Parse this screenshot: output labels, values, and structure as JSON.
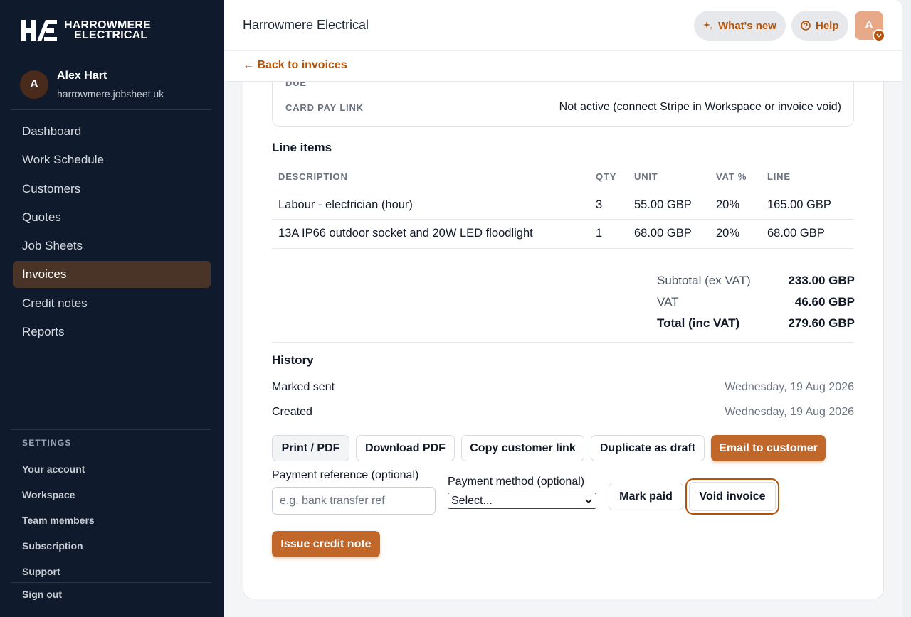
{
  "brand": {
    "name_line1": "HARROWMERE",
    "name_line2": "ELECTRICAL"
  },
  "user": {
    "initial": "A",
    "name": "Alex Hart",
    "domain": "harrowmere.jobsheet.uk"
  },
  "nav": [
    {
      "label": "Dashboard",
      "name": "dashboard",
      "active": false
    },
    {
      "label": "Work Schedule",
      "name": "work-schedule",
      "active": false
    },
    {
      "label": "Customers",
      "name": "customers",
      "active": false
    },
    {
      "label": "Quotes",
      "name": "quotes",
      "active": false
    },
    {
      "label": "Job Sheets",
      "name": "job-sheets",
      "active": false
    },
    {
      "label": "Invoices",
      "name": "invoices",
      "active": true
    },
    {
      "label": "Credit notes",
      "name": "credit-notes",
      "active": false
    },
    {
      "label": "Reports",
      "name": "reports",
      "active": false
    }
  ],
  "settings": {
    "heading": "SETTINGS",
    "items": [
      "Your account",
      "Workspace",
      "Team members",
      "Subscription",
      "Support"
    ],
    "sign_out": "Sign out"
  },
  "header": {
    "title": "Harrowmere Electrical",
    "whats_new": "What's new",
    "help": "Help",
    "avatar_initial": "A",
    "back_link": "← Back to invoices"
  },
  "payment_box": {
    "due_label_clipped": "DUE",
    "card_pay_label": "CARD PAY LINK",
    "card_pay_value": "Not active (connect Stripe in Workspace or invoice void)"
  },
  "line_items": {
    "heading": "Line items",
    "columns": [
      "DESCRIPTION",
      "QTY",
      "UNIT",
      "VAT %",
      "LINE"
    ],
    "rows": [
      [
        "Labour - electrician (hour)",
        "3",
        "55.00 GBP",
        "20%",
        "165.00 GBP"
      ],
      [
        "13A IP66 outdoor socket and 20W LED floodlight",
        "1",
        "68.00 GBP",
        "20%",
        "68.00 GBP"
      ]
    ]
  },
  "totals": {
    "subtotal_label": "Subtotal (ex VAT)",
    "subtotal": "233.00 GBP",
    "vat_label": "VAT",
    "vat": "46.60 GBP",
    "total_label": "Total (inc VAT)",
    "total": "279.60 GBP"
  },
  "history": {
    "heading": "History",
    "events": [
      {
        "label": "Marked sent",
        "date": "Wednesday, 19 Aug 2026"
      },
      {
        "label": "Created",
        "date": "Wednesday, 19 Aug 2026"
      }
    ]
  },
  "actions": {
    "print_pdf": "Print / PDF",
    "download_pdf": "Download PDF",
    "copy_link": "Copy customer link",
    "duplicate": "Duplicate as draft",
    "email": "Email to customer",
    "mark_paid": "Mark paid",
    "void": "Void invoice",
    "issue_credit": "Issue credit note"
  },
  "payment_form": {
    "reference_label": "Payment reference (optional)",
    "reference_placeholder": "e.g. bank transfer ref",
    "method_label": "Payment method (optional)",
    "method_value": "Select..."
  },
  "colors": {
    "accent": "#b45309",
    "sidebar": "#0f1b2c",
    "active_nav": "#4a3428",
    "primary_button": "#c2672a"
  }
}
